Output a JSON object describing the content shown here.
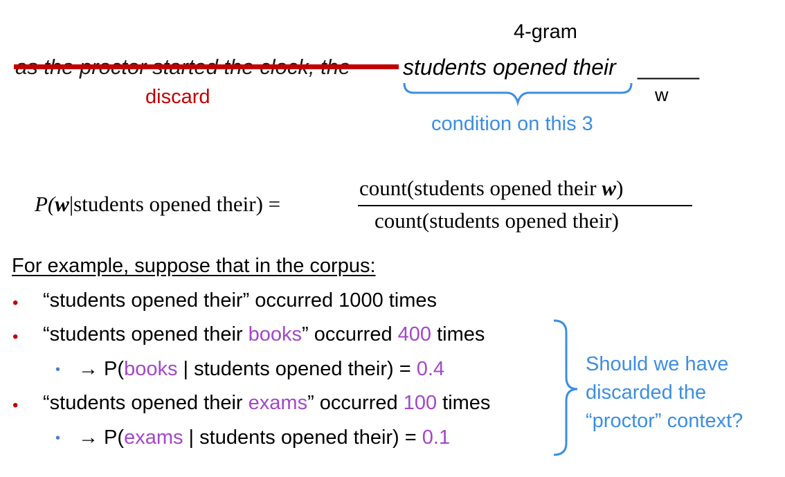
{
  "header": {
    "ngram_label": "4-gram",
    "struck_context": "as the proctor started the clock, the",
    "kept_context": "students opened their",
    "blank": "_____",
    "w_label": "w",
    "discard_label": "discard",
    "condition_label": "condition on this 3"
  },
  "formula": {
    "lhs_prefix": "P(",
    "lhs_var": "w",
    "lhs_mid": "|students opened their) =",
    "numerator_prefix": "count(students opened their ",
    "numerator_var": "w",
    "numerator_suffix": ")",
    "denominator": "count(students opened their)"
  },
  "example": {
    "header": "For example, suppose that in the corpus:",
    "line1": {
      "text": "“students opened their” occurred 1000 times"
    },
    "line2": {
      "pre": "“students opened their ",
      "word": "books",
      "mid": "” occurred ",
      "count": "400",
      "post": " times"
    },
    "line3": {
      "pre": "→ P(",
      "word": "books",
      "mid": " | students opened their) = ",
      "value": "0.4"
    },
    "line4": {
      "pre": "“students opened their ",
      "word": "exams",
      "mid": "” occurred ",
      "count": "100",
      "post": " times"
    },
    "line5": {
      "pre": "→ P(",
      "word": "exams",
      "mid": " | students opened their) = ",
      "value": "0.1"
    },
    "side_note": "Should we have discarded the “proctor” context?"
  },
  "colors": {
    "red": "#c00000",
    "blue": "#3b8ee0",
    "purple": "#a347c7"
  }
}
